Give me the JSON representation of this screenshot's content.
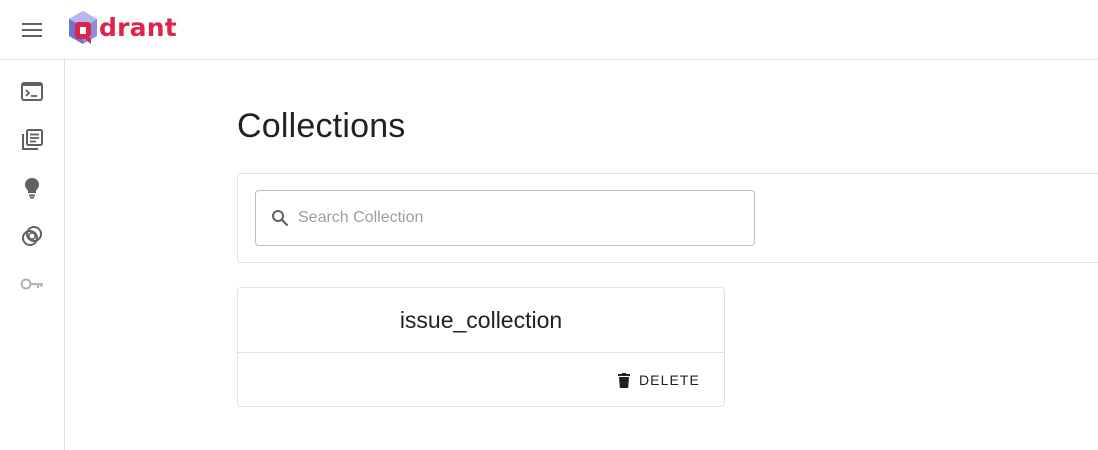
{
  "app": {
    "logo_text": "drant",
    "brand_color": "#dc244c",
    "menu_icon": "hamburger-menu-icon"
  },
  "sidebar": {
    "items": [
      {
        "icon": "terminal-console-icon"
      },
      {
        "icon": "collections-library-icon"
      },
      {
        "icon": "lightbulb-tutorial-icon"
      },
      {
        "icon": "datasets-rings-icon"
      },
      {
        "icon": "key-access-icon"
      }
    ]
  },
  "main": {
    "title": "Collections",
    "search": {
      "placeholder": "Search Collection",
      "value": "",
      "icon": "search-icon"
    },
    "collections": [
      {
        "name": "issue_collection",
        "delete_label": "DELETE",
        "delete_icon": "trash-icon"
      }
    ]
  }
}
